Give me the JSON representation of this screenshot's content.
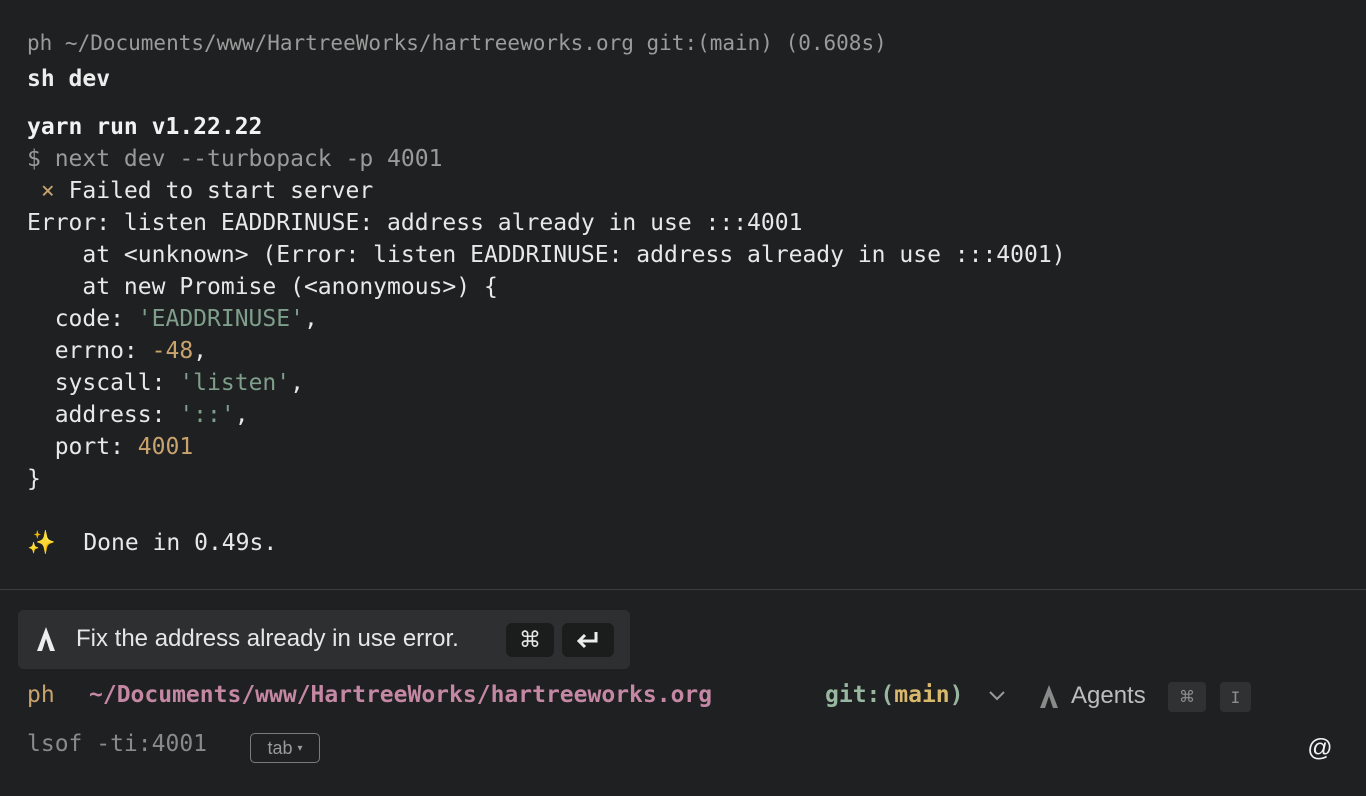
{
  "output": {
    "header": "ph ~/Documents/www/HartreeWorks/hartreeworks.org git:(main) (0.608s)",
    "command": "sh dev",
    "yarn_line": "yarn run v1.22.22",
    "next_cmd": "$ next dev --turbopack -p 4001",
    "fail_icon": "×",
    "fail_text": " Failed to start server",
    "error_line": "Error: listen EADDRINUSE: address already in use :::4001",
    "stack_1": "    at <unknown> (Error: listen EADDRINUSE: address already in use :::4001)",
    "stack_2": "    at new Promise (<anonymous>) {",
    "code_key": "  code: ",
    "code_val": "'EADDRINUSE'",
    "errno_key": "  errno: ",
    "errno_val": "-48",
    "syscall_key": "  syscall: ",
    "syscall_val": "'listen'",
    "address_key": "  address: ",
    "address_val": "'::'",
    "port_key": "  port: ",
    "port_val": "4001",
    "comma": ",",
    "close_brace": "}",
    "sparkle": "✨",
    "done_text": "  Done in 0.49s."
  },
  "suggestion": {
    "text": "Fix the address already in use error.",
    "key_cmd": "⌘",
    "key_enter": "↵"
  },
  "prompt": {
    "user": "ph",
    "path": "~/Documents/www/HartreeWorks/hartreeworks.org",
    "git_prefix": "git:(",
    "git_branch": "main",
    "git_suffix": ")",
    "agents_label": "Agents",
    "agents_key_cmd": "⌘",
    "agents_key_i": "I"
  },
  "input": {
    "ghost_text": "lsof -ti:4001",
    "tab_label": "tab",
    "at_symbol": "@"
  },
  "colors": {
    "background": "#1f2021",
    "user": "#c9a36e",
    "path": "#c487a4",
    "git": "#98b7a0",
    "string": "#7f9e8c",
    "number": "#c9a36e"
  },
  "icons": [
    "warp-agent-icon",
    "chevron-down-icon",
    "at-icon"
  ]
}
